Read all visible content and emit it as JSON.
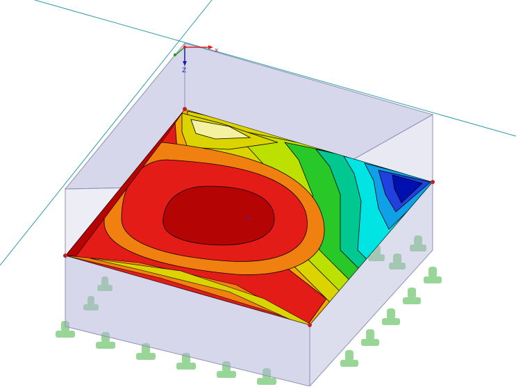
{
  "viewport": {
    "axis_x_label": "x",
    "axis_z_label": "Z",
    "colors": {
      "background": "#ffffff",
      "grid_line": "#2a9aa8",
      "box_fill": "#b4b6d8",
      "box_edge": "#8f90b4",
      "support": "#86cf86",
      "axis_x": "#e02020",
      "axis_z": "#1a1ab0",
      "axis_origin": "#20a020"
    },
    "contour_palette": [
      "#b40404",
      "#e41c18",
      "#f08010",
      "#f4a800",
      "#dcd400",
      "#bce000",
      "#28c828",
      "#00c890",
      "#00e4e4",
      "#10a0e8",
      "#2040e0",
      "#0010b0"
    ]
  }
}
